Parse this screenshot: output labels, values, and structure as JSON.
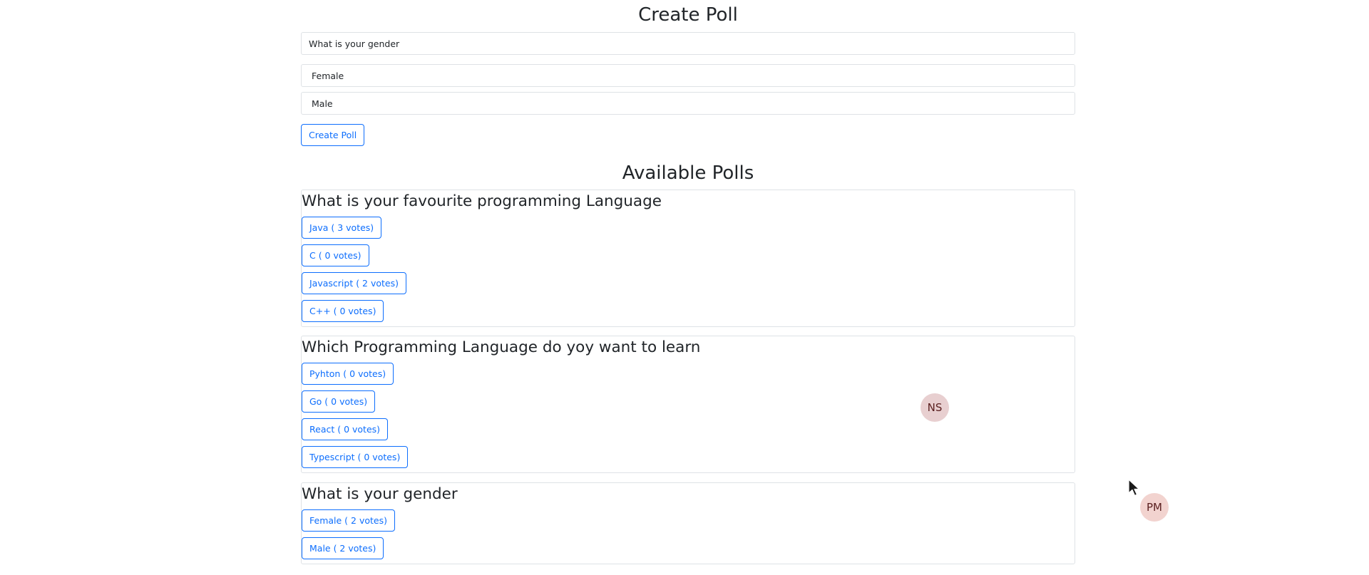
{
  "create_poll": {
    "title": "Create Poll",
    "question_value": "What is your gender",
    "options": [
      "Female",
      "Male"
    ],
    "submit_label": "Create Poll"
  },
  "available_polls": {
    "title": "Available Polls",
    "polls": [
      {
        "question": "What is your favourite programming Language",
        "options": [
          "Java ( 3 votes)",
          "C ( 0 votes)",
          "Javascript ( 2 votes)",
          "C++ ( 0 votes)"
        ]
      },
      {
        "question": "Which Programming Language do yoy want to learn",
        "options": [
          "Pyhton ( 0 votes)",
          "Go ( 0 votes)",
          "React ( 0 votes)",
          "Typescript ( 0 votes)"
        ]
      },
      {
        "question": "What is your gender",
        "options": [
          "Female ( 2 votes)",
          "Male ( 2 votes)"
        ]
      }
    ]
  },
  "presence": [
    {
      "initials": "NS",
      "color": "#e8cfd0"
    },
    {
      "initials": "PM",
      "color": "#f2d3cf"
    }
  ],
  "colors": {
    "accent": "#0d6efd",
    "border": "#dee2e6",
    "text": "#212529"
  }
}
